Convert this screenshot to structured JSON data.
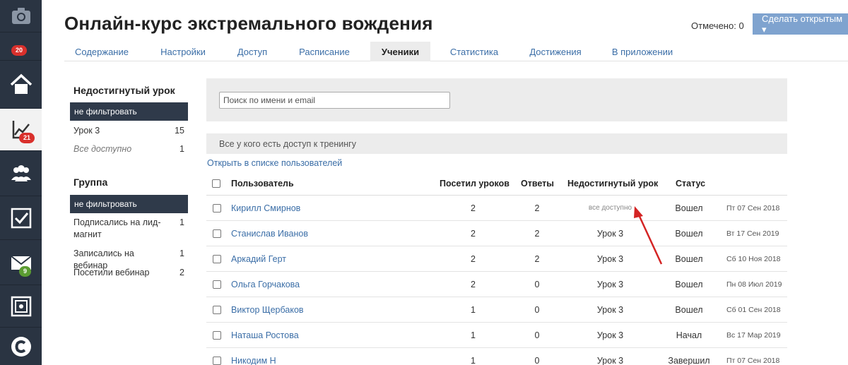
{
  "rail": {
    "badges": {
      "top": "20",
      "analytics": "21",
      "mail": "9"
    }
  },
  "header": {
    "title": "Онлайн-курс экстремального вождения",
    "marked": "Отмечено: 0",
    "make_open": "Сделать открытым"
  },
  "tabs": [
    "Содержание",
    "Настройки",
    "Доступ",
    "Расписание",
    "Ученики",
    "Статистика",
    "Достижения",
    "В приложении"
  ],
  "filters": {
    "lesson": {
      "title": "Недостигнутый урок",
      "selected": "не фильтровать",
      "items": [
        {
          "label": "Урок 3",
          "count": "15"
        },
        {
          "label": "Все доступно",
          "count": "1"
        }
      ]
    },
    "group": {
      "title": "Группа",
      "selected": "не фильтровать",
      "items": [
        {
          "label": "Подписались на лид-магнит",
          "count": "1"
        },
        {
          "label": "Записались на вебинар",
          "count": "1"
        },
        {
          "label": "Посетили вебинар",
          "count": "2"
        }
      ]
    }
  },
  "main": {
    "search_placeholder": "Поиск по имени и email",
    "access_text": "Все у кого есть доступ к тренингу",
    "open_list": "Открыть в списке пользователей",
    "columns": {
      "user": "Пользователь",
      "visited": "Посетил уроков",
      "answers": "Ответы",
      "unreached": "Недостигнутый урок",
      "status": "Статус"
    },
    "rows": [
      {
        "user": "Кирилл Смирнов",
        "visited": "2",
        "answers": "2",
        "unreached": "все доступно",
        "status": "Вошел",
        "date": "Пт 07 Сен 2018"
      },
      {
        "user": "Станислав Иванов",
        "visited": "2",
        "answers": "2",
        "unreached": "Урок 3",
        "status": "Вошел",
        "date": "Вт 17 Сен 2019"
      },
      {
        "user": "Аркадий Герт",
        "visited": "2",
        "answers": "2",
        "unreached": "Урок 3",
        "status": "Вошел",
        "date": "Сб 10 Ноя 2018"
      },
      {
        "user": "Ольга Горчакова",
        "visited": "2",
        "answers": "0",
        "unreached": "Урок 3",
        "status": "Вошел",
        "date": "Пн 08 Июл 2019"
      },
      {
        "user": "Виктор Щербаков",
        "visited": "1",
        "answers": "0",
        "unreached": "Урок 3",
        "status": "Вошел",
        "date": "Сб 01 Сен 2018"
      },
      {
        "user": "Наташа Ростова",
        "visited": "1",
        "answers": "0",
        "unreached": "Урок 3",
        "status": "Начал",
        "date": "Вс 17 Мар 2019"
      },
      {
        "user": "Никодим Н",
        "visited": "1",
        "answers": "0",
        "unreached": "Урок 3",
        "status": "Завершил",
        "date": "Пт 07 Сен 2018"
      }
    ]
  },
  "colors": {
    "rail": "#2a3442",
    "accent": "#3b6ea7",
    "button": "#7fa3cf",
    "arrow": "#d42424"
  }
}
